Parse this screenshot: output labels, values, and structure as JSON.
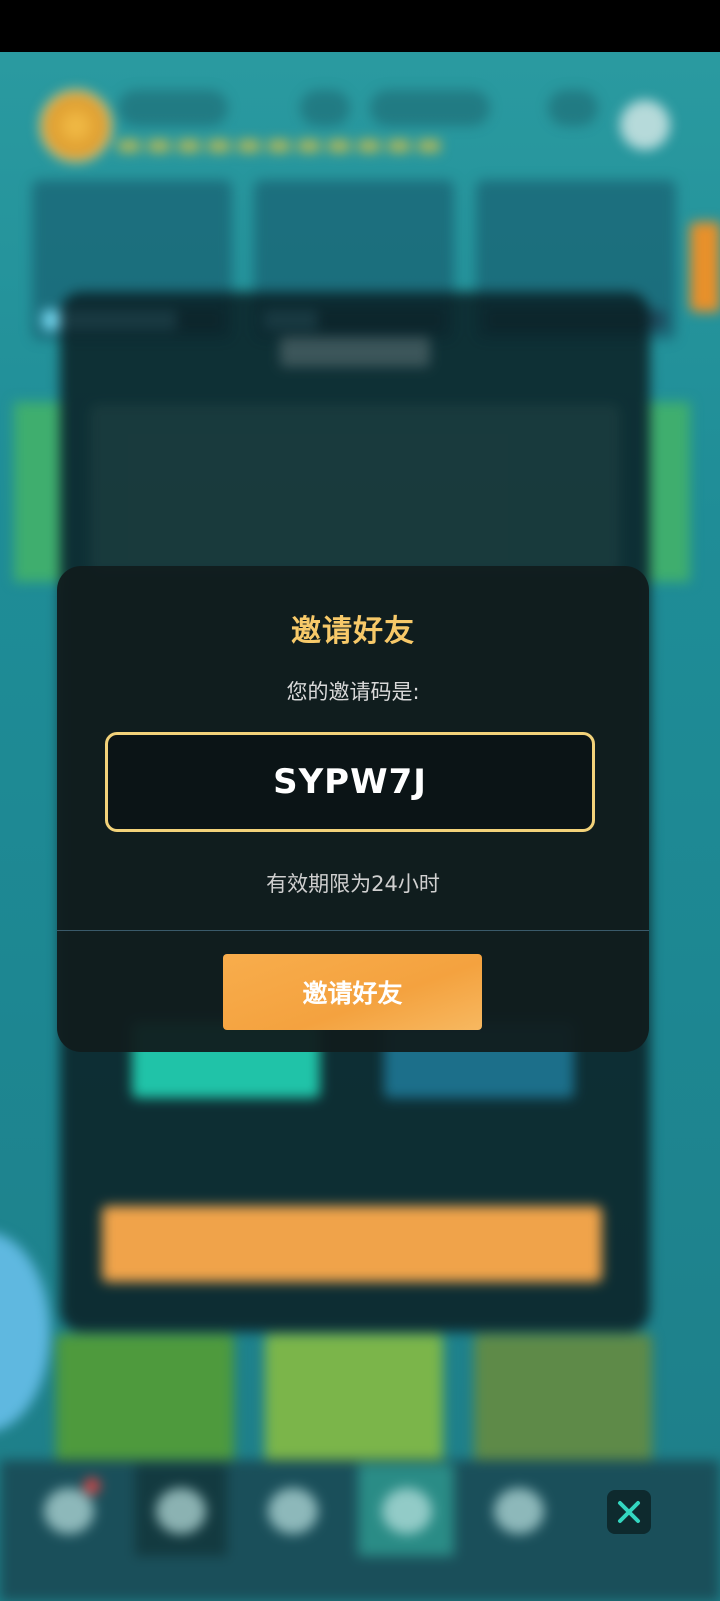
{
  "dialog": {
    "title": "邀请好友",
    "subtitle": "您的邀请码是:",
    "invite_code": "SYPW7J",
    "validity_note": "有效期限为24小时",
    "invite_button_label": "邀请好友"
  },
  "colors": {
    "title": "#f7c969",
    "code_border": "#f2d27a",
    "button": "#f4a23f"
  },
  "icons": {
    "close": "close-x-icon"
  }
}
